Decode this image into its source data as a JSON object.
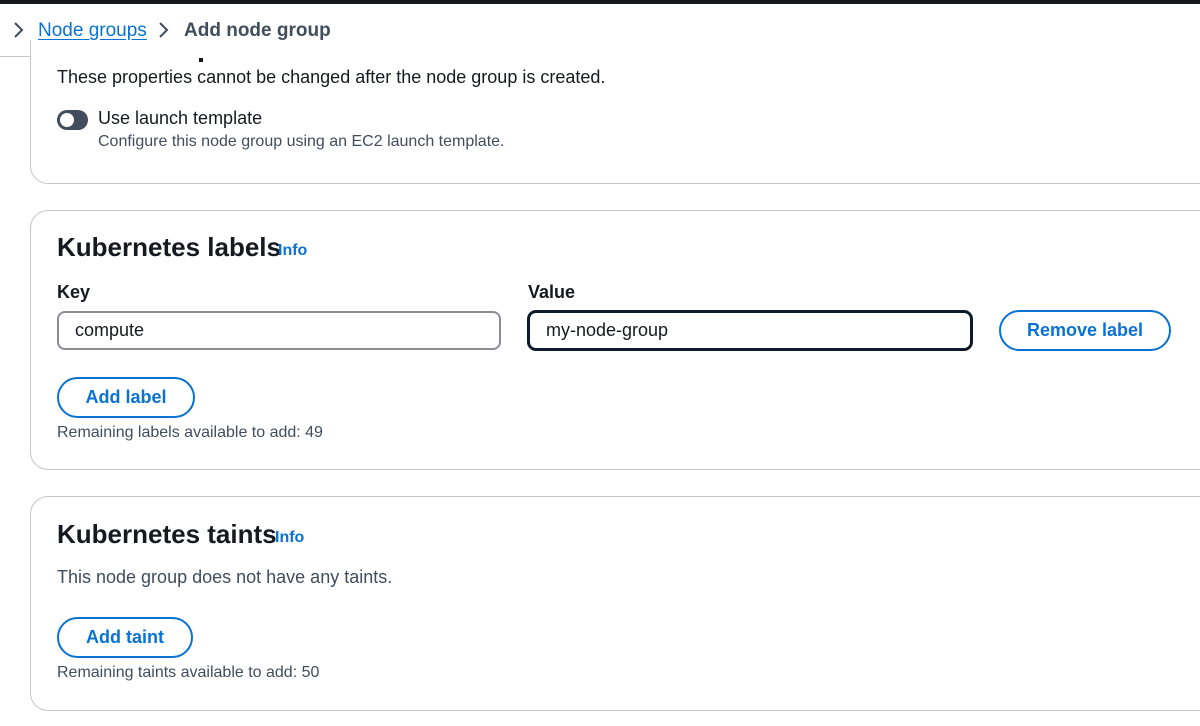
{
  "breadcrumb": {
    "items": [
      {
        "label": "Node groups",
        "link": true
      },
      {
        "label": "Add node group",
        "link": false
      }
    ]
  },
  "node_group_config": {
    "description": "These properties cannot be changed after the node group is created.",
    "launch_template_toggle": {
      "label": "Use launch template",
      "description": "Configure this node group using an EC2 launch template.",
      "enabled": false
    }
  },
  "kubernetes_labels": {
    "title": "Kubernetes labels",
    "info": "Info",
    "key_label": "Key",
    "value_label": "Value",
    "rows": [
      {
        "key": "compute",
        "value": "my-node-group"
      }
    ],
    "remove_button": "Remove label",
    "add_button": "Add label",
    "remaining": "Remaining labels available to add: 49"
  },
  "kubernetes_taints": {
    "title": "Kubernetes taints",
    "info": "Info",
    "empty_text": "This node group does not have any taints.",
    "add_button": "Add taint",
    "remaining": "Remaining taints available to add: 50"
  },
  "colors": {
    "link": "#0972d3",
    "text": "#16191f",
    "muted": "#414d5c",
    "border": "#c6c6cd"
  }
}
